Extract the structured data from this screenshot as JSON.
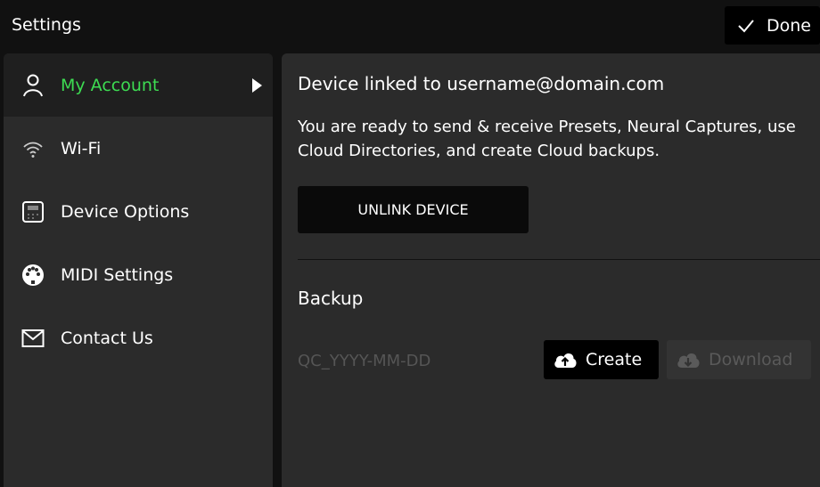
{
  "header": {
    "title": "Settings",
    "done_label": "Done"
  },
  "sidebar": {
    "items": [
      {
        "label": "My Account",
        "icon": "person-icon",
        "active": true
      },
      {
        "label": "Wi-Fi",
        "icon": "wifi-icon",
        "active": false
      },
      {
        "label": "Device Options",
        "icon": "device-icon",
        "active": false
      },
      {
        "label": "MIDI Settings",
        "icon": "midi-icon",
        "active": false
      },
      {
        "label": "Contact Us",
        "icon": "mail-icon",
        "active": false
      }
    ]
  },
  "main": {
    "heading": "Device linked to username@domain.com",
    "description": "You are ready to send & receive Presets, Neural Captures, use Cloud Directories, and create Cloud backups.",
    "unlink_label": "UNLINK DEVICE",
    "backup": {
      "heading": "Backup",
      "filename_placeholder": "QC_YYYY-MM-DD",
      "create_label": "Create",
      "download_label": "Download"
    }
  },
  "colors": {
    "accent": "#3ddc52",
    "background": "#111111",
    "panel": "#2b2b2b",
    "active_item": "#1f1f1f"
  }
}
